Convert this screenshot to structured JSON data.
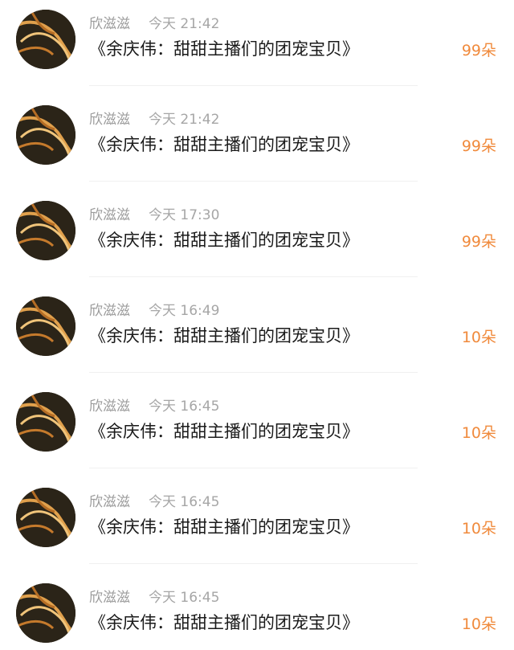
{
  "gift_list": [
    {
      "name": "欣滋滋",
      "time": "今天 21:42",
      "title": "《余庆伟：甜甜主播们的团宠宝贝》",
      "gift": "99朵"
    },
    {
      "name": "欣滋滋",
      "time": "今天 21:42",
      "title": "《余庆伟：甜甜主播们的团宠宝贝》",
      "gift": "99朵"
    },
    {
      "name": "欣滋滋",
      "time": "今天 17:30",
      "title": "《余庆伟：甜甜主播们的团宠宝贝》",
      "gift": "99朵"
    },
    {
      "name": "欣滋滋",
      "time": "今天 16:49",
      "title": "《余庆伟：甜甜主播们的团宠宝贝》",
      "gift": "10朵"
    },
    {
      "name": "欣滋滋",
      "time": "今天 16:45",
      "title": "《余庆伟：甜甜主播们的团宠宝贝》",
      "gift": "10朵"
    },
    {
      "name": "欣滋滋",
      "time": "今天 16:45",
      "title": "《余庆伟：甜甜主播们的团宠宝贝》",
      "gift": "10朵"
    },
    {
      "name": "欣滋滋",
      "time": "今天 16:45",
      "title": "《余庆伟：甜甜主播们的团宠宝贝》",
      "gift": "10朵"
    }
  ],
  "colors": {
    "name": "#9b9b9b",
    "time": "#a6a6a6",
    "title": "#1a1a1a",
    "gift": "#f08a3c"
  }
}
